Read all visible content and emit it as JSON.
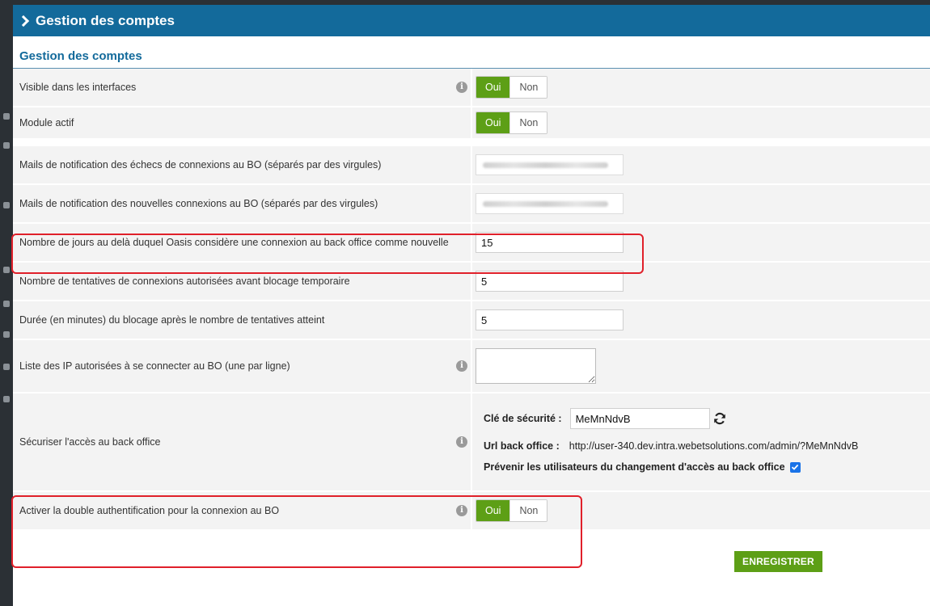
{
  "header": {
    "title": "Gestion des comptes"
  },
  "section": {
    "title": "Gestion des comptes"
  },
  "rows": {
    "visible": {
      "label": "Visible dans les interfaces",
      "yes": "Oui",
      "no": "Non",
      "selected": "Oui"
    },
    "module": {
      "label": "Module actif",
      "yes": "Oui",
      "no": "Non",
      "selected": "Oui"
    },
    "mail_fail": {
      "label": "Mails de notification des échecs de connexions au BO (séparés par des virgules)"
    },
    "mail_new": {
      "label": "Mails de notification des nouvelles connexions au BO (séparés par des virgules)"
    },
    "days": {
      "label": "Nombre de jours au delà duquel Oasis considère une connexion au back office comme nouvelle",
      "value": "15"
    },
    "attempts": {
      "label": "Nombre de tentatives de connexions autorisées avant blocage temporaire",
      "value": "5"
    },
    "duration": {
      "label": "Durée (en minutes) du blocage après le nombre de tentatives atteint",
      "value": "5"
    },
    "ips": {
      "label": "Liste des IP autorisées à se connecter au BO (une par ligne)",
      "value": ""
    },
    "secure": {
      "label": "Sécuriser l'accès au back office",
      "key_label": "Clé de sécurité :",
      "key_value": "MeMnNdvB",
      "url_label": "Url back office :",
      "url_value": "http://user-340.dev.intra.webetsolutions.com/admin/?MeMnNdvB",
      "notify_label": "Prévenir les utilisateurs du changement d'accès au back office",
      "notify_checked": true
    },
    "twofa": {
      "label": "Activer la double authentification pour la connexion au BO",
      "yes": "Oui",
      "no": "Non",
      "selected": "Oui"
    }
  },
  "save_label": "ENREGISTRER",
  "colors": {
    "header": "#136a9b",
    "accent_green": "#5d9f16",
    "highlight": "#e0202a"
  },
  "icons": {
    "header": "chevron-right-icon",
    "info": "info-icon",
    "refresh": "refresh-icon",
    "check": "checkbox-checked-icon"
  }
}
